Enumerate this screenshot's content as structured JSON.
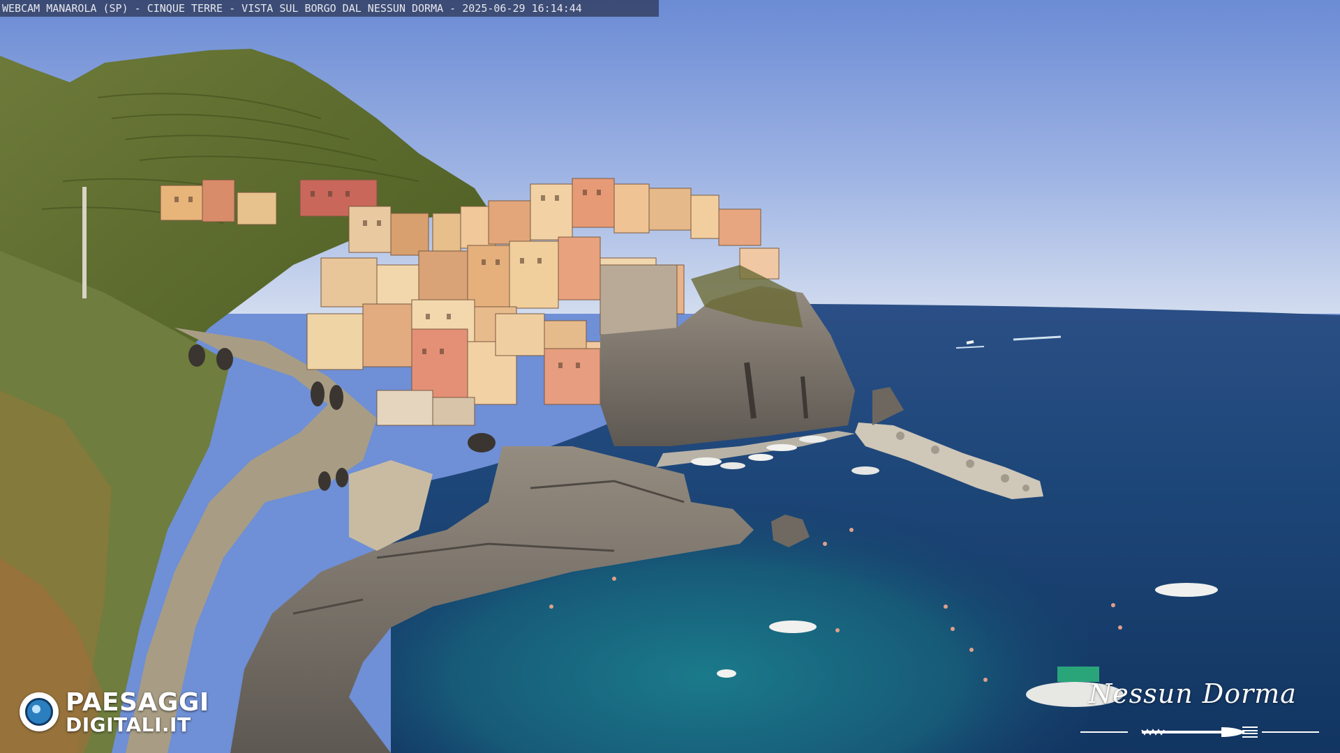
{
  "webcam": {
    "caption": "WEBCAM MANAROLA (SP) - CINQUE TERRE - VISTA SUL BORGO DAL NESSUN DORMA - 2025-06-29 16:14:44"
  },
  "brand": {
    "line1": "PAESAGGI",
    "line2": "DIGITALI.IT"
  },
  "partner": {
    "name": "Nessun Dorma"
  },
  "colors": {
    "sky_top": "#6f8fd6",
    "sky_horizon": "#c9d6ee",
    "sea_deep": "#1c3f6e",
    "sea_shallow": "#1e6e86",
    "cliff": "#7d776f",
    "hill_green": "#5b6b2c"
  }
}
